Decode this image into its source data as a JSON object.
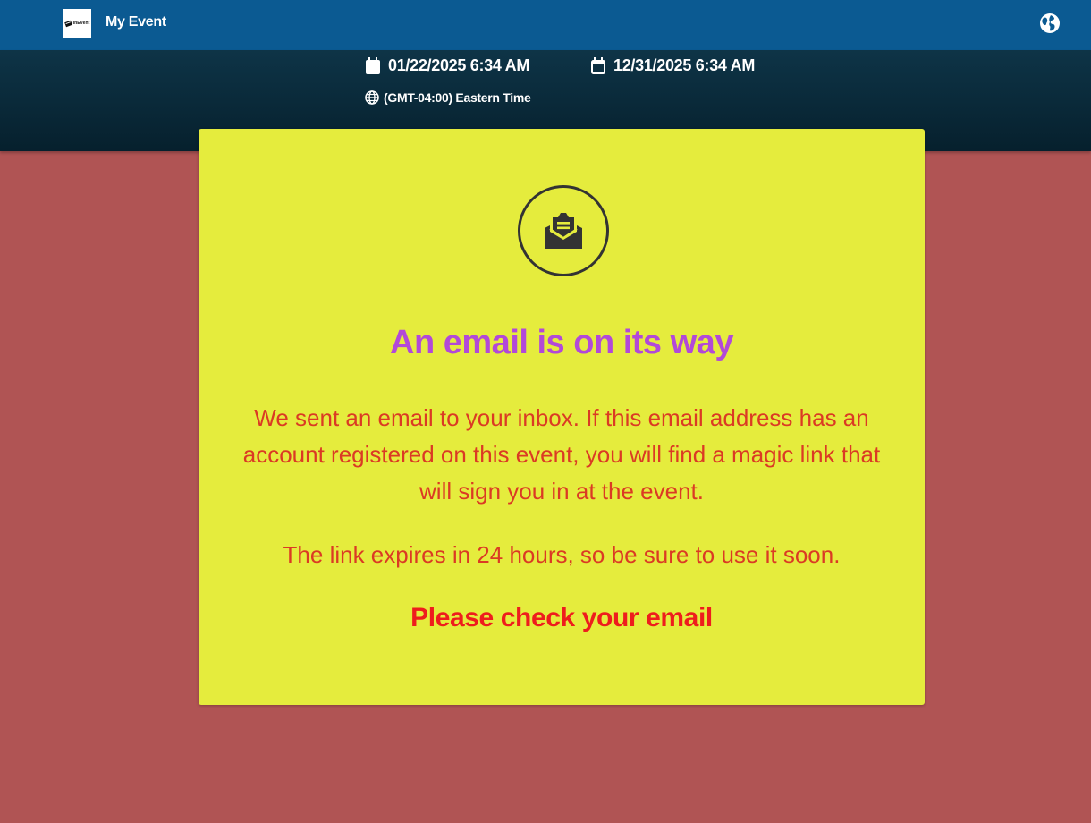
{
  "header": {
    "logo_text": "inEvent",
    "event_title": "My Event"
  },
  "dates": {
    "start": "01/22/2025 6:34 AM",
    "end": "12/31/2025 6:34 AM",
    "timezone": "(GMT-04:00) Eastern Time"
  },
  "card": {
    "heading": "An email is on its way",
    "body": "We sent an email to your inbox. If this email address has an account registered on this event, you will find a magic link that will sign you in at the event.",
    "expiry": "The link expires in 24 hours, so be sure to use it soon.",
    "cta": "Please check your email"
  },
  "icons": {
    "logo": "inevent-logo",
    "language": "globe-icon",
    "start_date": "calendar-filled-icon",
    "end_date": "calendar-outline-icon",
    "timezone": "globe-icon",
    "mail": "envelope-open-icon"
  },
  "colors": {
    "header_bg": "#0b5a92",
    "hero_bg": "#0a2a3a",
    "page_bg": "#b05454",
    "card_bg": "#e5ec3d",
    "heading": "#b249d8",
    "body_text": "#db3a24",
    "cta_text": "#ee1d1d"
  }
}
